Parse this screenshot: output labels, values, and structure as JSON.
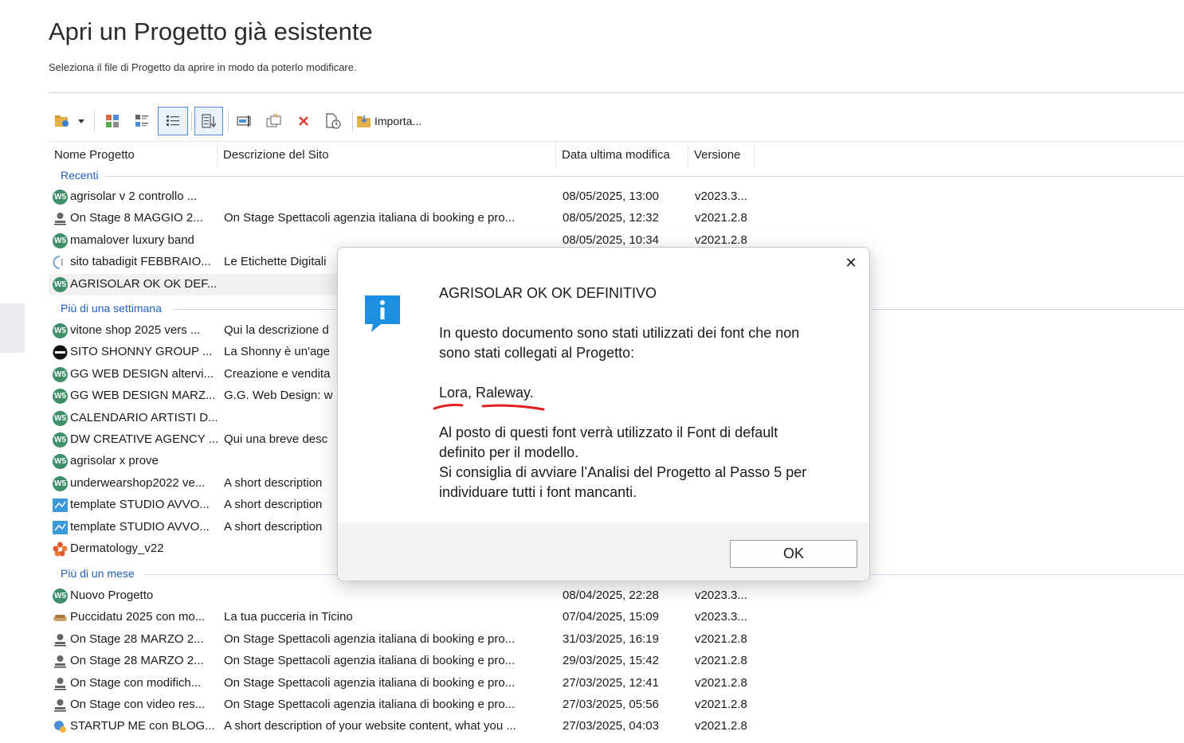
{
  "page": {
    "title": "Apri un Progetto già esistente",
    "subtitle": "Seleziona il file di Progetto da aprire in modo da poterlo modificare."
  },
  "toolbar": {
    "import_label": "Importa...",
    "icons": [
      "new-project-icon",
      "dropdown-arrow-icon",
      "large-icons-view-icon",
      "tiles-view-icon",
      "list-view-icon",
      "sort-icon",
      "rename-icon",
      "duplicate-icon",
      "delete-icon",
      "history-icon",
      "import-folder-icon"
    ]
  },
  "columns": {
    "name": "Nome Progetto",
    "desc": "Descrizione del Sito",
    "date": "Data ultima modifica",
    "version": "Versione"
  },
  "groups": {
    "recent": "Recenti",
    "week": "Più di una settimana",
    "month": "Più di un mese"
  },
  "rows_recent": [
    {
      "name": "agrisolar v 2 controllo ...",
      "desc": "",
      "date": "08/05/2025, 13:00",
      "version": "v2023.3...",
      "icon": "ws"
    },
    {
      "name": "On Stage 8 MAGGIO 2...",
      "desc": "On Stage Spettacoli agenzia italiana di booking e pro...",
      "date": "08/05/2025, 12:32",
      "version": "v2021.2.8",
      "icon": "person"
    },
    {
      "name": "mamalover luxury band",
      "desc": "",
      "date": "08/05/2025, 10:34",
      "version": "v2021.2.8",
      "icon": "ws"
    },
    {
      "name": "sito tabadigit FEBBRAIO...",
      "desc": "Le Etichette Digitali",
      "date": "",
      "version": "",
      "icon": "tabadigit"
    },
    {
      "name": "AGRISOLAR OK OK DEF...",
      "desc": "",
      "date": "",
      "version": "",
      "icon": "ws"
    }
  ],
  "rows_week": [
    {
      "name": "vitone shop 2025 vers ...",
      "desc": "Qui la descrizione d",
      "icon": "ws"
    },
    {
      "name": "SITO SHONNY GROUP ...",
      "desc": "La Shonny è un'age",
      "icon": "shonny"
    },
    {
      "name": "GG WEB DESIGN altervi...",
      "desc": "Creazione e vendita",
      "icon": "ws"
    },
    {
      "name": "GG WEB DESIGN MARZ...",
      "desc": "G.G. Web Design: w",
      "icon": "ws"
    },
    {
      "name": "CALENDARIO ARTISTI D...",
      "desc": "",
      "icon": "ws"
    },
    {
      "name": "DW CREATIVE AGENCY ...",
      "desc": "Qui una breve desc",
      "icon": "ws"
    },
    {
      "name": "agrisolar x prove",
      "desc": "",
      "icon": "ws"
    },
    {
      "name": "underwearshop2022 ve...",
      "desc": "A short description",
      "icon": "ws"
    },
    {
      "name": "template STUDIO AVVO...",
      "desc": "A short description",
      "icon": "template"
    },
    {
      "name": "template STUDIO AVVO...",
      "desc": "A short description",
      "icon": "template"
    },
    {
      "name": "Dermatology_v22",
      "desc": "",
      "icon": "flower"
    }
  ],
  "rows_month": [
    {
      "name": "Nuovo Progetto",
      "desc": "",
      "date": "08/04/2025, 22:28",
      "version": "v2023.3...",
      "icon": "ws"
    },
    {
      "name": "Puccidatu 2025 con mo...",
      "desc": "La tua pucceria in Ticino",
      "date": "07/04/2025, 15:09",
      "version": "v2023.3...",
      "icon": "bread"
    },
    {
      "name": "On Stage 28 MARZO 2...",
      "desc": "On Stage Spettacoli agenzia italiana di booking e pro...",
      "date": "31/03/2025, 16:19",
      "version": "v2021.2.8",
      "icon": "person"
    },
    {
      "name": "On Stage 28 MARZO 2...",
      "desc": "On Stage Spettacoli agenzia italiana di booking e pro...",
      "date": "29/03/2025, 15:42",
      "version": "v2021.2.8",
      "icon": "person"
    },
    {
      "name": "On Stage con modifich...",
      "desc": "On Stage Spettacoli agenzia italiana di booking e pro...",
      "date": "27/03/2025, 12:41",
      "version": "v2021.2.8",
      "icon": "person"
    },
    {
      "name": "On Stage con video res...",
      "desc": "On Stage Spettacoli agenzia italiana di booking e pro...",
      "date": "27/03/2025, 05:56",
      "version": "v2021.2.8",
      "icon": "person"
    },
    {
      "name": "STARTUP ME con BLOG...",
      "desc": "A short description  of your website content, what you ...",
      "date": "27/03/2025, 04:03",
      "version": "v2021.2.8",
      "icon": "startup"
    }
  ],
  "dialog": {
    "title": "AGRISOLAR OK OK DEFINITIVO",
    "msg_line1": "In questo documento sono stati utilizzati dei font che non",
    "msg_line2": "sono stati collegati al Progetto:",
    "fonts": "Lora, Raleway.",
    "msg2_line1": "Al posto di questi font verrà utilizzato il Font di default",
    "msg2_line2": "definito per il modello.",
    "msg2_line3": "Si consiglia di avviare l’Analisi del Progetto al Passo 5 per",
    "msg2_line4": "individuare tutti i font mancanti.",
    "ok_label": "OK",
    "close_glyph": "✕",
    "icon": "info-icon",
    "annotation_color": "#e02020"
  }
}
